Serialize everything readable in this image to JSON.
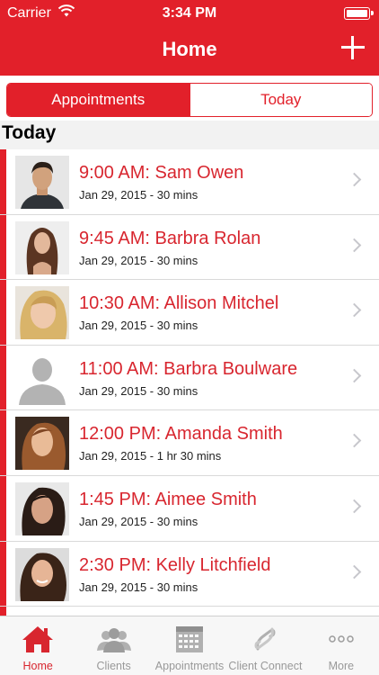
{
  "status_bar": {
    "carrier": "Carrier",
    "time": "3:34 PM"
  },
  "nav": {
    "title": "Home"
  },
  "segments": [
    {
      "label": "Appointments",
      "selected": true
    },
    {
      "label": "Today",
      "selected": false
    }
  ],
  "section": {
    "title": "Today"
  },
  "appointments": [
    {
      "title": "9:00 AM: Sam Owen",
      "subtitle": "Jan 29, 2015 - 30 mins"
    },
    {
      "title": "9:45 AM: Barbra Rolan",
      "subtitle": "Jan 29, 2015 - 30 mins"
    },
    {
      "title": "10:30 AM: Allison Mitchel",
      "subtitle": "Jan 29, 2015 - 30 mins"
    },
    {
      "title": "11:00 AM: Barbra Boulware",
      "subtitle": "Jan 29, 2015 - 30 mins"
    },
    {
      "title": "12:00 PM: Amanda Smith",
      "subtitle": "Jan 29, 2015 - 1 hr 30 mins"
    },
    {
      "title": "1:45 PM: Aimee Smith",
      "subtitle": "Jan 29, 2015 - 30 mins"
    },
    {
      "title": "2:30 PM: Kelly Litchfield",
      "subtitle": "Jan 29, 2015 - 30 mins"
    }
  ],
  "tabs": [
    {
      "label": "Home",
      "icon": "home-icon",
      "active": true
    },
    {
      "label": "Clients",
      "icon": "clients-icon",
      "active": false
    },
    {
      "label": "Appointments",
      "icon": "calendar-icon",
      "active": false
    },
    {
      "label": "Client Connect",
      "icon": "client-connect-icon",
      "active": false
    },
    {
      "label": "More",
      "icon": "more-icon",
      "active": false
    }
  ],
  "colors": {
    "brand": "#e2202a",
    "text_accent": "#d8262f",
    "inactive_tab": "#999999"
  }
}
